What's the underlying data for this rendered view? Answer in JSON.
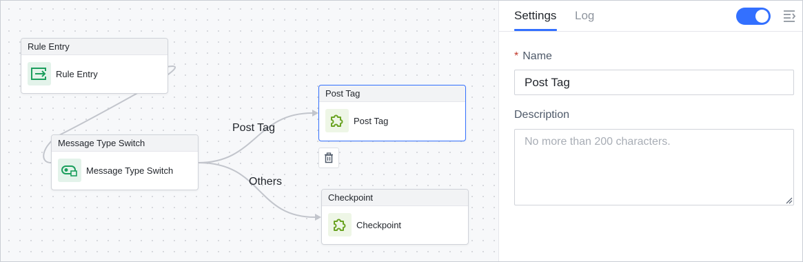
{
  "canvas": {
    "nodes": {
      "rule_entry": {
        "title": "Rule Entry",
        "label": "Rule Entry",
        "icon": "arrow-right-box-icon"
      },
      "message_type_switch": {
        "title": "Message Type Switch",
        "label": "Message Type Switch",
        "icon": "toggle-switch-icon"
      },
      "post_tag": {
        "title": "Post Tag",
        "label": "Post Tag",
        "icon": "puzzle-icon",
        "selected": true
      },
      "checkpoint": {
        "title": "Checkpoint",
        "label": "Checkpoint",
        "icon": "puzzle-icon"
      }
    },
    "edges": {
      "post_tag_label": "Post Tag",
      "others_label": "Others"
    },
    "delete_icon": "trash-icon"
  },
  "panel": {
    "tabs": [
      {
        "label": "Settings",
        "active": true
      },
      {
        "label": "Log",
        "active": false
      }
    ],
    "enabled": true,
    "menu_icon": "collapse-menu-icon",
    "name_field": {
      "label": "Name",
      "required_mark": "*",
      "value": "Post Tag"
    },
    "description_field": {
      "label": "Description",
      "value": "",
      "placeholder": "No more than 200 characters."
    }
  },
  "colors": {
    "accent": "#3370ff",
    "node_icon_green": "#1a9e5c",
    "puzzle_icon_green": "#6aa322"
  }
}
